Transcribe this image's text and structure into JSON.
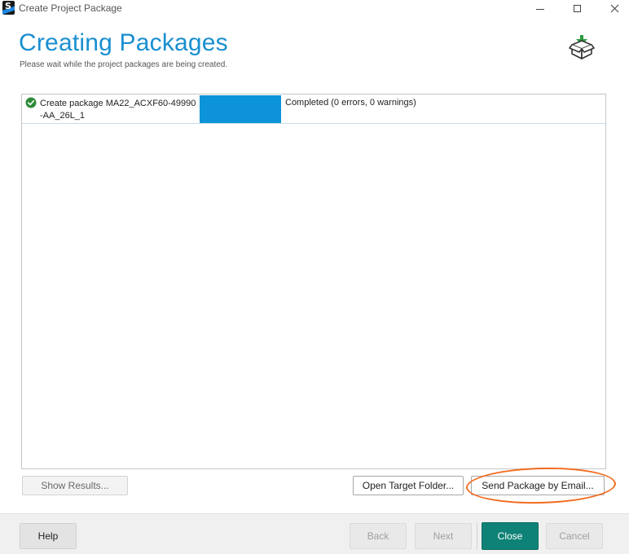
{
  "window": {
    "title": "Create Project Package",
    "app_icon_letter": "S"
  },
  "header": {
    "title": "Creating Packages",
    "subtitle": "Please wait while the project packages are being created.",
    "icon": "package-box-download-icon"
  },
  "tasks": [
    {
      "name": "Create package MA22_ACXF60-49990-AA_26L_1",
      "progress": 1.0,
      "status": "Completed (0 errors, 0 warnings)",
      "status_icon": "check-circle-icon"
    }
  ],
  "actions": {
    "show_results": "Show Results...",
    "open_target_folder": "Open Target Folder...",
    "send_package_by_email": "Send Package by Email..."
  },
  "footer": {
    "help": "Help",
    "back": "Back",
    "next": "Next",
    "close": "Close",
    "cancel": "Cancel"
  },
  "colors": {
    "accent": "#1a8fd0",
    "progress": "#0d94d8",
    "primary_button": "#0f8277",
    "success": "#2e8b3a",
    "highlight": "#f26b1d"
  }
}
